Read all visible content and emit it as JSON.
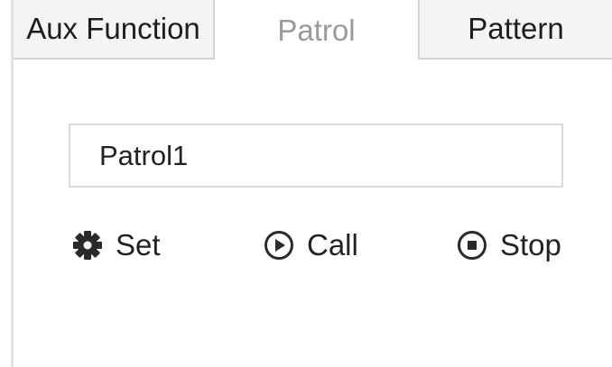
{
  "tabs": [
    {
      "label": "Aux Function",
      "active": false
    },
    {
      "label": "Patrol",
      "active": true
    },
    {
      "label": "Pattern",
      "active": false
    }
  ],
  "patrol": {
    "selected": "Patrol1"
  },
  "actions": {
    "set_label": "Set",
    "call_label": "Call",
    "stop_label": "Stop",
    "set_icon": "gear-icon",
    "call_icon": "play-circle-icon",
    "stop_icon": "stop-circle-icon"
  },
  "colors": {
    "inactive_tab_bg": "#f4f4f4",
    "active_tab_text": "#9a9a9a",
    "text": "#222222",
    "border": "#d9d9d9"
  }
}
